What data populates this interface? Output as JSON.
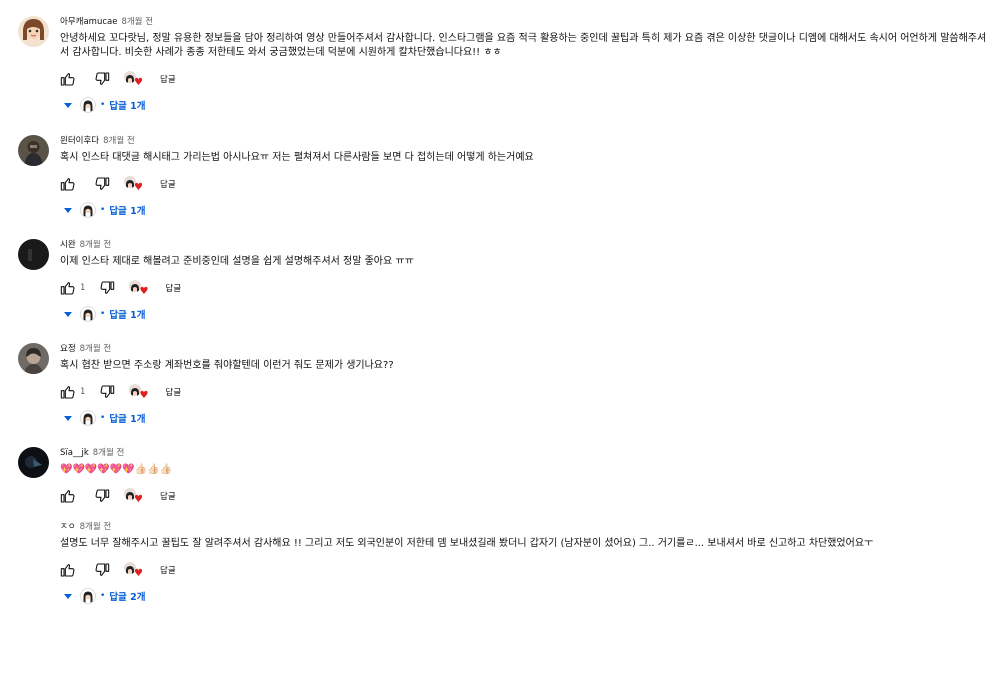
{
  "ui": {
    "reply_label": "답글",
    "heart_symbol": "♥",
    "reply_dot": "•",
    "accent_color": "#065fd4",
    "heart_color": "#e02020"
  },
  "comments": [
    {
      "author": "아무캐amucae",
      "time": "8개월 전",
      "text": "안녕하세요 꼬다랏님, 정말 유용한 정보들을 담아 정리하여 영상 만들어주셔서 감사합니다. 인스타그램을 요즘 적극 활용하는 중인데 꿀팁과 특히 제가 요즘 겪은 이상한 댓글이나 디엠에 대해서도 속시어 어언하게 말씀해주셔서 감사합니다. 비슷한 사례가 종종 저한테도 와서 궁금했었는데 덕분에 시원하게 칼차단했습니다요!! ㅎㅎ",
      "likes": "",
      "replies": "답글 1개",
      "avatar_icon": "cartoon-girl-avatar"
    },
    {
      "author": "윈터이후다",
      "time": "8개월 전",
      "text": "혹시 인스타 대댓글 해시태그 가리는법 아시나요ㅠ 저는 펼쳐져서 다른사람들 보면 다 접히는데 어떻게 하는거예요",
      "likes": "",
      "replies": "답글 1개",
      "avatar_icon": "warrior-avatar"
    },
    {
      "author": "시완",
      "time": "8개월 전",
      "text": "이제 인스타 제대로 해볼려고 준비중인데 설명을 쉽게 설명해주셔서 정말 좋아요 ㅠㅠ",
      "likes": "1",
      "replies": "답글 1개",
      "avatar_icon": "dark-avatar"
    },
    {
      "author": "요정",
      "time": "8개월 전",
      "text": "혹시 협찬 받으면 주소랑 계좌번호를 줘야할텐데 이런거 줘도 문제가 생기나요??",
      "likes": "1",
      "replies": "답글 1개",
      "avatar_icon": "photo-avatar"
    },
    {
      "author": "Sïa__jk",
      "time": "8개월 전",
      "text": "💖💖💖💖💖💖👍🏻👍🏻👍🏻",
      "likes": "",
      "replies": "",
      "avatar_icon": "night-avatar"
    },
    {
      "author": "ㅈㅇ",
      "time": "8개월 전",
      "text": "설명도 너무 잘해주시고 꿀팁도 잘 알려주셔서 감사해요 !! 그리고 저도 외국인분이 저한테 뎀 보내셨길래 봤더니 갑자기 (남자분이 셨어요) 그.. 거기를ㄹ... 보내셔서 바로 신고하고 차단했었어요ㅜ",
      "likes": "",
      "replies": "답글 2개",
      "avatar_icon": "blank-avatar"
    }
  ]
}
